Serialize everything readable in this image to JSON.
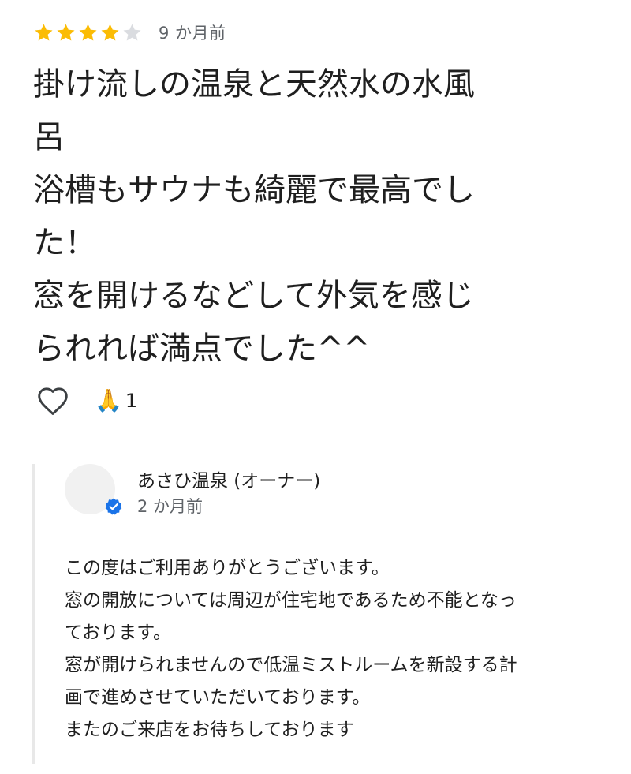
{
  "review": {
    "rating": 4,
    "max_rating": 5,
    "time": "9 か月前",
    "text": "掛け流しの温泉と天然水の水風\n呂\n浴槽もサウナも綺麗で最高でし\nた！\n窓を開けるなどして外気を感じ\nられれば満点でした^^",
    "colors": {
      "star_filled": "#fbbc04",
      "star_empty": "#dadce0"
    }
  },
  "actions": {
    "like_icon": "heart-outline-icon",
    "reaction_emoji": "🙏",
    "reaction_count": "1"
  },
  "owner_reply": {
    "name": "あさひ温泉 (オーナー)",
    "time": "2 か月前",
    "badge_icon": "verified-check-icon",
    "badge_color": "#1a73e8",
    "text": "この度はご利用ありがとうございます。\n窓の開放については周辺が住宅地であるため不能となっ\nております。\n窓が開けられませんので低温ミストルームを新設する計\n画で進めさせていただいております。\nまたのご来店をお待ちしております"
  }
}
